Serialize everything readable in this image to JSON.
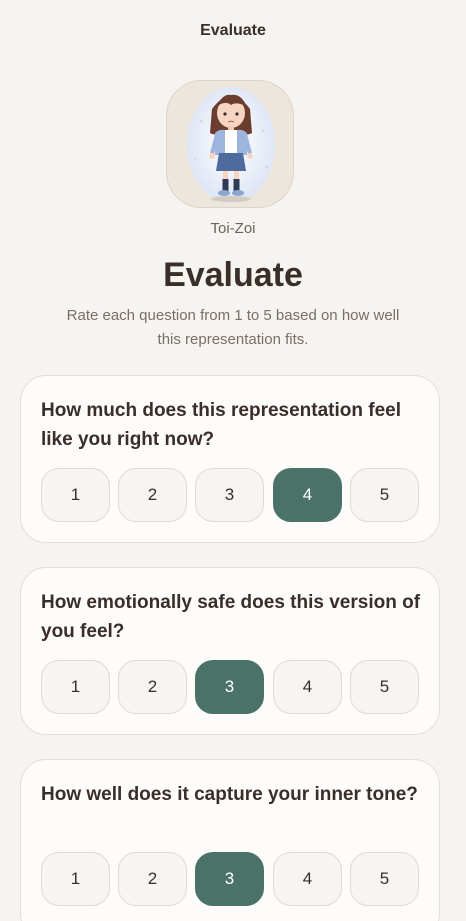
{
  "header": {
    "title": "Evaluate"
  },
  "avatar": {
    "name": "Toi-Zoi"
  },
  "intro": {
    "title": "Evaluate",
    "subtitle": "Rate each question from 1 to 5 based on how well this representation fits."
  },
  "questions": [
    {
      "text": "How much does this representation feel like you right now?",
      "options": [
        "1",
        "2",
        "3",
        "4",
        "5"
      ],
      "selected": 4
    },
    {
      "text": "How emotionally safe does this version of you feel?",
      "options": [
        "1",
        "2",
        "3",
        "4",
        "5"
      ],
      "selected": 3
    },
    {
      "text": "How well does it capture your inner tone?",
      "options": [
        "1",
        "2",
        "3",
        "4",
        "5"
      ],
      "selected": 3
    }
  ],
  "colors": {
    "accent": "#4b7268",
    "background": "#f6f4f0",
    "card": "#fdfcfa",
    "text": "#3a2e2a"
  }
}
